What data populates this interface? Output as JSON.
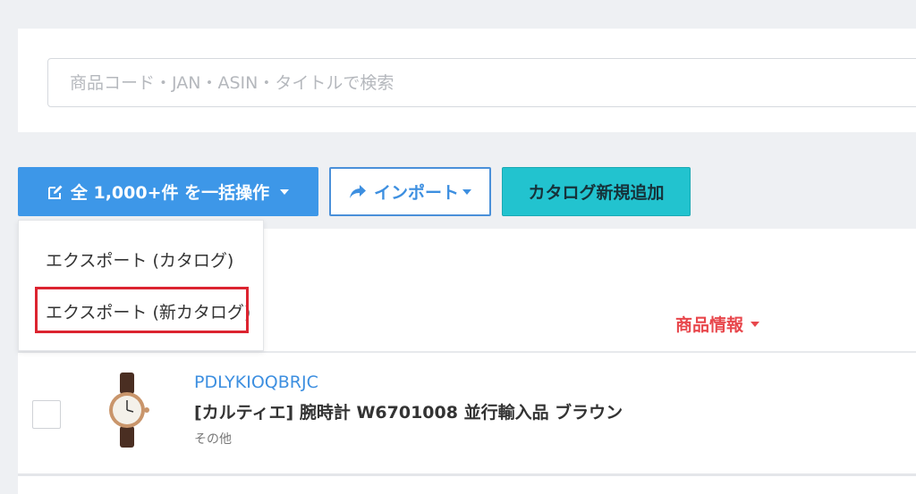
{
  "search": {
    "placeholder": "商品コード・JAN・ASIN・タイトルで検索",
    "value": ""
  },
  "toolbar": {
    "bulk_label": "全 1,000+件 を一括操作",
    "import_label": "インポート",
    "add_label": "カタログ新規追加"
  },
  "dropdown": {
    "items": [
      {
        "label": "エクスポート (カタログ)"
      },
      {
        "label": "エクスポート (新カタログ)",
        "highlighted": true
      }
    ]
  },
  "table": {
    "header_label": "商品情報",
    "rows": [
      {
        "sku": "PDLYKIOQBRJC",
        "title": "[カルティエ] 腕時計 W6701008 並行輸入品 ブラウン",
        "category": "その他"
      }
    ]
  },
  "colors": {
    "primary": "#3d97e8",
    "teal": "#22c3cf",
    "sort_header": "#e8474c",
    "highlight": "#dc2430",
    "link": "#3d8fe0"
  },
  "icons": [
    "edit-icon",
    "share-arrow-icon",
    "watch-thumbnail"
  ]
}
